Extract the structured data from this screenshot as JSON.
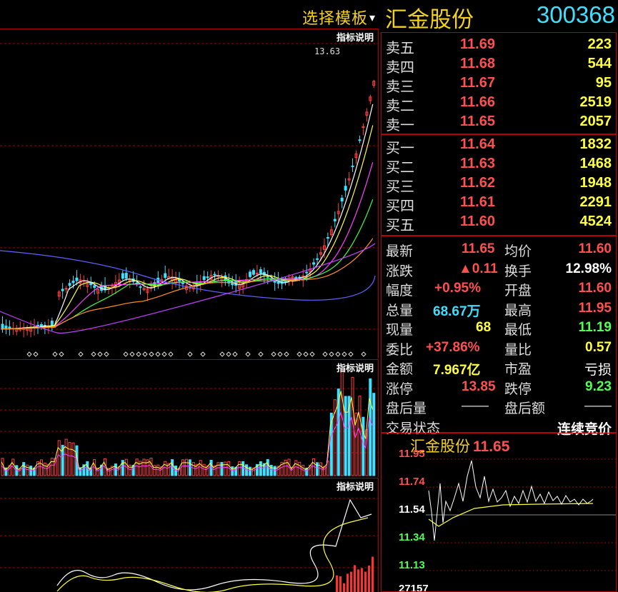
{
  "header": {
    "template_label": "选择模板",
    "stock_name": "汇金股份",
    "stock_code": "300368"
  },
  "chart_panels": {
    "panel1_tag": "指标说明",
    "panel1_high_label": "13.63",
    "panel2_tag": "指标说明",
    "panel3_tag": "指标说明"
  },
  "order_book": {
    "asks": [
      {
        "label": "卖五",
        "price": "11.69",
        "volume": "223"
      },
      {
        "label": "卖四",
        "price": "11.68",
        "volume": "544"
      },
      {
        "label": "卖三",
        "price": "11.67",
        "volume": "95"
      },
      {
        "label": "卖二",
        "price": "11.66",
        "volume": "2519"
      },
      {
        "label": "卖一",
        "price": "11.65",
        "volume": "2057"
      }
    ],
    "bids": [
      {
        "label": "买一",
        "price": "11.64",
        "volume": "1832"
      },
      {
        "label": "买二",
        "price": "11.63",
        "volume": "1468"
      },
      {
        "label": "买三",
        "price": "11.62",
        "volume": "1948"
      },
      {
        "label": "买四",
        "price": "11.61",
        "volume": "2291"
      },
      {
        "label": "买五",
        "price": "11.60",
        "volume": "4524"
      }
    ]
  },
  "quote": {
    "latest_label": "最新",
    "latest": "11.65",
    "avg_label": "均价",
    "avg": "11.60",
    "change_label": "涨跌",
    "change": "▲0.11",
    "turnover_label": "换手",
    "turnover": "12.98%",
    "amplitude_label": "幅度",
    "amplitude": "+0.95%",
    "open_label": "开盘",
    "open": "11.60",
    "total_vol_label": "总量",
    "total_vol": "68.67万",
    "high_label": "最高",
    "high": "11.95",
    "cur_vol_label": "现量",
    "cur_vol": "68",
    "low_label": "最低",
    "low": "11.19",
    "committee_label": "委比",
    "committee": "+37.86%",
    "vol_ratio_label": "量比",
    "vol_ratio": "0.57",
    "amount_label": "金额",
    "amount": "7.967亿",
    "pe_label": "市盈",
    "pe": "亏损",
    "limit_up_label": "涨停",
    "limit_up": "13.85",
    "limit_down_label": "跌停",
    "limit_down": "9.23",
    "after_vol_label": "盘后量",
    "after_vol": "——",
    "after_amt_label": "盘后额",
    "after_amt": "——",
    "status_label": "交易状态",
    "status": "连续竞价"
  },
  "mini_chart": {
    "title": "汇金股份",
    "price": "11.65",
    "axis": [
      "11.95",
      "11.74",
      "11.54",
      "11.34",
      "11.13",
      "27157"
    ]
  },
  "colors": {
    "up": "#ff5050",
    "down": "#50ff50",
    "yellow": "#ffff3c",
    "cyan": "#3fe0ff",
    "border": "#b00000"
  }
}
